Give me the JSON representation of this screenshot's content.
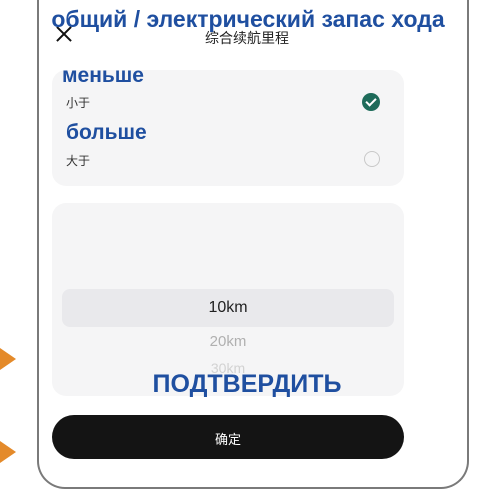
{
  "header": {
    "title_cn": "综合续航里程",
    "overlay_title": "общий / электрический запас хода"
  },
  "options": [
    {
      "label_cn": "小于",
      "overlay": "меньше",
      "selected": true
    },
    {
      "label_cn": "大于",
      "overlay": "больше",
      "selected": false
    }
  ],
  "picker": {
    "items": [
      "10km",
      "20km",
      "30km"
    ],
    "selected": "10km"
  },
  "confirm": {
    "label_cn": "确定",
    "overlay": "ПОДТВЕРДИТЬ"
  },
  "colors": {
    "accent": "#1e6b5a",
    "annotation_text": "#1f4fa0",
    "annotation_arrow": "#e48a2a",
    "button_bg": "#141414"
  },
  "icons": [
    "close-icon",
    "check-icon",
    "radio-empty-icon",
    "arrow-icon"
  ]
}
